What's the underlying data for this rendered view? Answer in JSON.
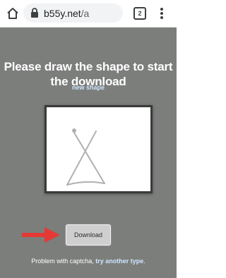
{
  "browser": {
    "url_domain": "b55y.net",
    "url_path": "/a",
    "tab_count": "2"
  },
  "page": {
    "headline_line1": "Please draw the shape to start",
    "headline_line2": "the download",
    "new_shape_link": "new shape",
    "download_button": "Download",
    "captcha_text": "Problem with captcha,",
    "captcha_link": "try another type",
    "captcha_period": "."
  },
  "icons": [
    "home-icon",
    "lock-icon",
    "tabs-icon",
    "overflow-menu-icon",
    "red-arrow-icon"
  ],
  "colors": {
    "page_background": "#7c7e7c",
    "link": "#cfe6ff",
    "arrow": "#e53935",
    "shape_stroke": "#b0b0b0"
  }
}
